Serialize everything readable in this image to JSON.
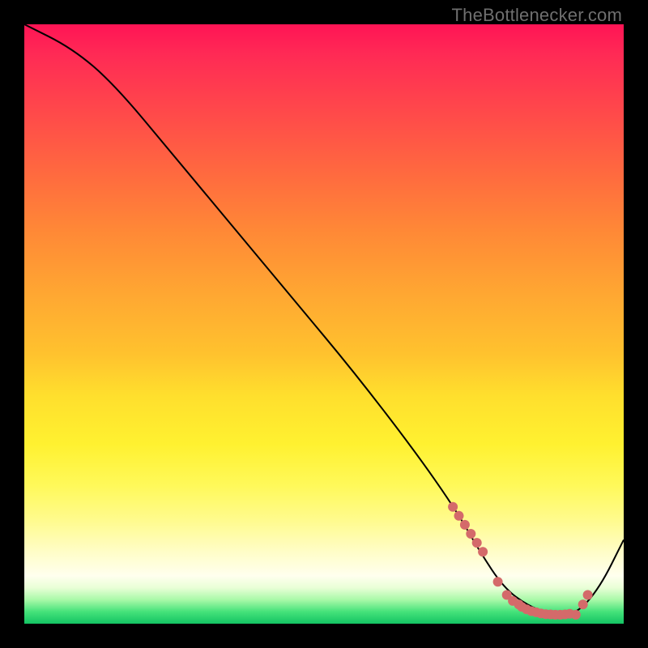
{
  "attribution": "TheBottlenecker.com",
  "colors": {
    "background": "#000000",
    "gradient_top": "#ff1455",
    "gradient_mid": "#ffe02e",
    "gradient_bottom": "#13c463",
    "curve": "#000000",
    "marker": "#d46a6a"
  },
  "chart_data": {
    "type": "line",
    "title": "",
    "xlabel": "",
    "ylabel": "",
    "xlim": [
      0,
      100
    ],
    "ylim": [
      0,
      100
    ],
    "x": [
      0,
      8,
      15,
      25,
      35,
      45,
      55,
      65,
      72,
      76,
      80,
      84,
      88,
      92,
      96,
      100
    ],
    "values": [
      100,
      96,
      90,
      78,
      66,
      54,
      42,
      29,
      19,
      12,
      6,
      3,
      1.5,
      1.5,
      6,
      14
    ],
    "markers_x": [
      71.5,
      72.5,
      73.5,
      74.5,
      75.5,
      76.5,
      79,
      80.5,
      81.5,
      82.5,
      83,
      83.8,
      84.6,
      85.4,
      86.2,
      87,
      87.8,
      88.6,
      89.4,
      90.2,
      91,
      92,
      93.2,
      94
    ],
    "markers_values": [
      19.5,
      18,
      16.5,
      15,
      13.5,
      12,
      7,
      4.8,
      3.8,
      3.2,
      2.8,
      2.4,
      2.1,
      1.9,
      1.7,
      1.6,
      1.55,
      1.5,
      1.5,
      1.55,
      1.65,
      1.5,
      3.2,
      4.8
    ]
  }
}
